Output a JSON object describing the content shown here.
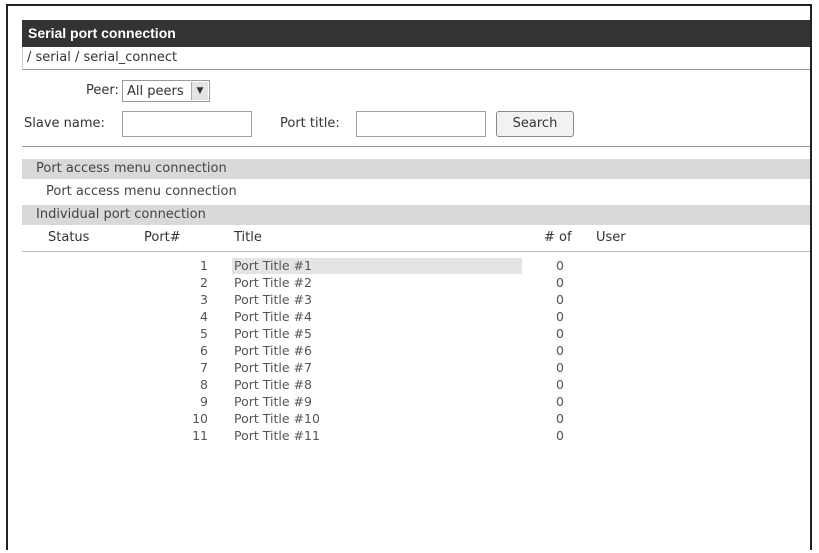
{
  "window": {
    "title": "Serial port connection",
    "breadcrumb": "/ serial / serial_connect"
  },
  "form": {
    "peer_label": "Peer:",
    "peer_value": "All peers",
    "slave_label": "Slave name:",
    "port_title_label": "Port title:",
    "search_button": "Search"
  },
  "sections": {
    "port_access_header": "Port access menu connection",
    "port_access_link": "Port access menu connection",
    "individual_header": "Individual port connection"
  },
  "table": {
    "headers": {
      "status": "Status",
      "port": "Port#",
      "title": "Title",
      "count": "# of",
      "user": "User"
    },
    "rows": [
      {
        "port": "1",
        "title": "Port Title #1",
        "count": "0"
      },
      {
        "port": "2",
        "title": "Port Title #2",
        "count": "0"
      },
      {
        "port": "3",
        "title": "Port Title #3",
        "count": "0"
      },
      {
        "port": "4",
        "title": "Port Title #4",
        "count": "0"
      },
      {
        "port": "5",
        "title": "Port Title #5",
        "count": "0"
      },
      {
        "port": "6",
        "title": "Port Title #6",
        "count": "0"
      },
      {
        "port": "7",
        "title": "Port Title #7",
        "count": "0"
      },
      {
        "port": "8",
        "title": "Port Title #8",
        "count": "0"
      },
      {
        "port": "9",
        "title": "Port Title #9",
        "count": "0"
      },
      {
        "port": "10",
        "title": "Port Title #10",
        "count": "0"
      },
      {
        "port": "11",
        "title": "Port Title #11",
        "count": "0"
      }
    ]
  }
}
